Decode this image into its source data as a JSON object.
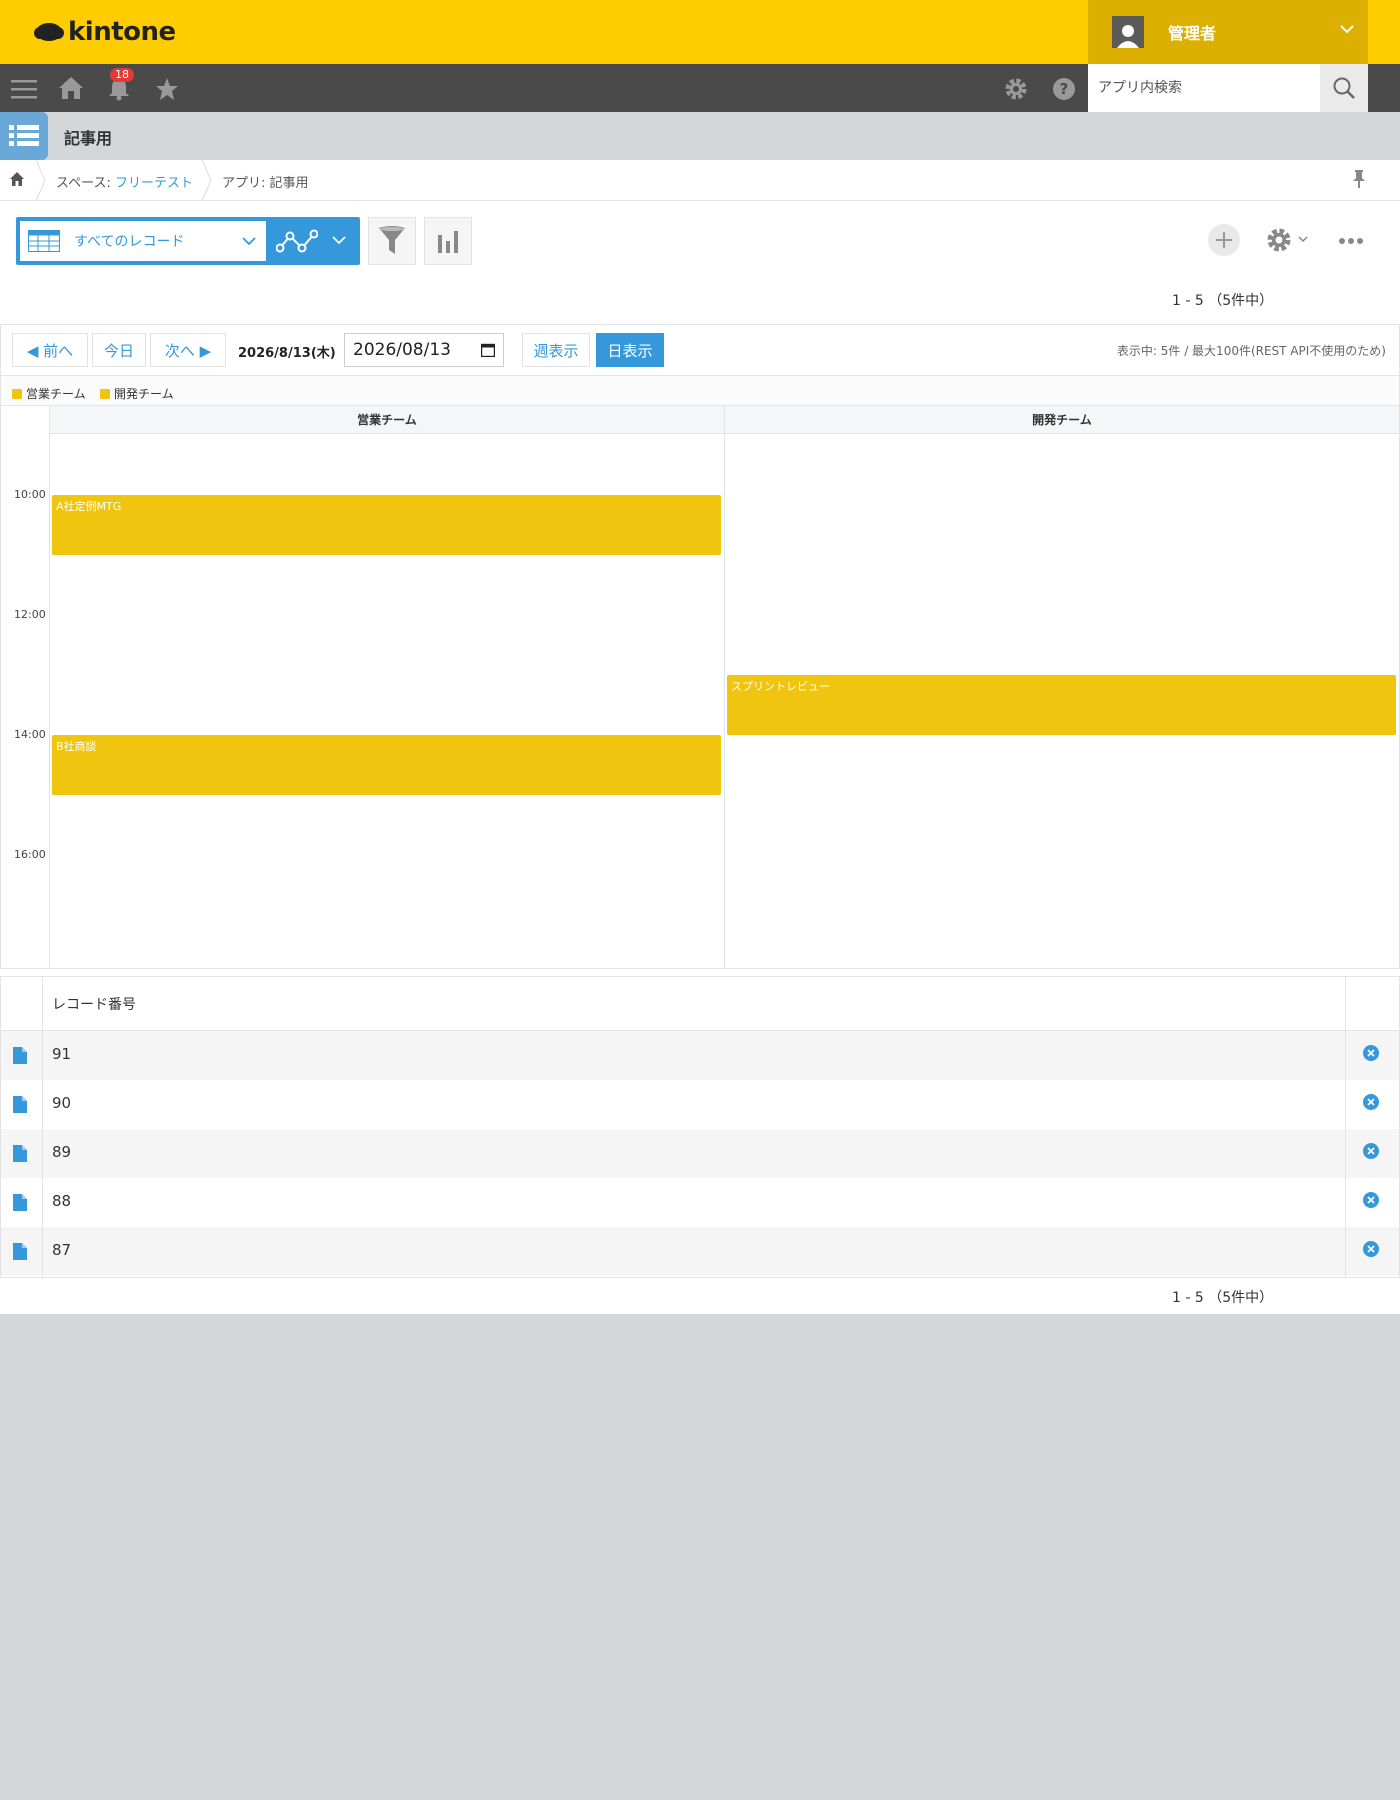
{
  "header": {
    "logo_text": "kintone",
    "user_name": "管理者",
    "notification_count": "18",
    "search_placeholder": "アプリ内検索"
  },
  "app": {
    "title": "記事用"
  },
  "breadcrumb": {
    "space_prefix": "スペース: ",
    "space_name": "フリーテスト",
    "app_label": "アプリ: 記事用"
  },
  "view": {
    "selected": "すべてのレコード"
  },
  "pager": {
    "text": "1 - 5 （5件中）"
  },
  "calendar": {
    "prev_label": "◀ 前へ",
    "today_label": "今日",
    "next_label": "次へ ▶",
    "current_date": "2026/8/13(木)",
    "date_input_value": "2026/08/13",
    "week_view_label": "週表示",
    "day_view_label": "日表示",
    "info": "表示中: 5件 / 最大100件(REST API不使用のため)",
    "legend": [
      "営業チーム",
      "開発チーム"
    ],
    "columns": [
      "営業チーム",
      "開発チーム"
    ],
    "times": [
      "10:00",
      "12:00",
      "14:00",
      "16:00"
    ],
    "event_color": "#f0c50f",
    "events": [
      {
        "title": "A社定例MTG",
        "team": "営業チーム",
        "start": "10:00",
        "end": "11:00"
      },
      {
        "title": "スプリントレビュー",
        "team": "開発チーム",
        "start": "13:00",
        "end": "14:00"
      },
      {
        "title": "B社商談",
        "team": "営業チーム",
        "start": "14:00",
        "end": "15:00"
      }
    ]
  },
  "table": {
    "column_header": "レコード番号",
    "rows": [
      "91",
      "90",
      "89",
      "88",
      "87"
    ]
  },
  "colors": {
    "brand_yellow": "#ffcc00",
    "nav_dark": "#4a4a4a",
    "accent_blue": "#3498db"
  },
  "icons": [
    "menu-icon",
    "home-icon",
    "bell-icon",
    "star-icon",
    "gear-icon",
    "help-icon",
    "search-icon",
    "pin-icon",
    "funnel-icon",
    "bar-chart-icon",
    "plus-icon",
    "more-icon",
    "document-icon",
    "delete-icon"
  ]
}
